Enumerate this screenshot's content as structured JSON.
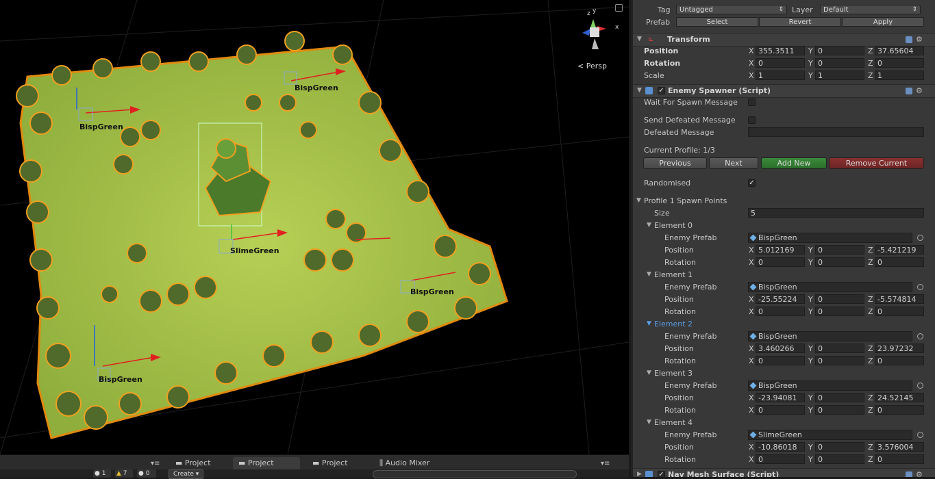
{
  "scene": {
    "persp_label": "Persp",
    "gizmo_axes": {
      "y": "y",
      "z": "z",
      "x": "x"
    },
    "object_labels": [
      "BispGreen",
      "BispGreen",
      "SlimeGreen",
      "BispGreen",
      "BispGreen"
    ]
  },
  "bottom": {
    "tabs": [
      "Project",
      "Project",
      "Project",
      "Audio Mixer"
    ],
    "create_label": "Create",
    "console_counts": [
      "1",
      "7",
      "0"
    ]
  },
  "inspector": {
    "tag_label": "Tag",
    "tag_value": "Untagged",
    "layer_label": "Layer",
    "layer_value": "Default",
    "prefab_label": "Prefab",
    "prefab_buttons": [
      "Select",
      "Revert",
      "Apply"
    ],
    "transform": {
      "title": "Transform",
      "position": {
        "label": "Position",
        "x": "355.3511",
        "y": "0",
        "z": "37.65604"
      },
      "rotation": {
        "label": "Rotation",
        "x": "0",
        "y": "0",
        "z": "0"
      },
      "scale": {
        "label": "Scale",
        "x": "1",
        "y": "1",
        "z": "1"
      }
    },
    "spawner": {
      "title": "Enemy Spawner (Script)",
      "wait_label": "Wait For Spawn Message",
      "send_label": "Send Defeated Message",
      "defeated_label": "Defeated Message",
      "current_profile": "Current Profile: 1/3",
      "buttons": {
        "previous": "Previous",
        "next": "Next",
        "add": "Add New",
        "remove": "Remove Current"
      },
      "randomised_label": "Randomised",
      "points_label": "Profile 1 Spawn Points",
      "size_label": "Size",
      "size_value": "5",
      "field_labels": {
        "prefab": "Enemy Prefab",
        "position": "Position",
        "rotation": "Rotation"
      },
      "elements": [
        {
          "name": "Element 0",
          "prefab": "BispGreen",
          "px": "5.012169",
          "py": "0",
          "pz": "-5.421219",
          "rx": "0",
          "ry": "0",
          "rz": "0"
        },
        {
          "name": "Element 1",
          "prefab": "BispGreen",
          "px": "-25.55224",
          "py": "0",
          "pz": "-5.574814",
          "rx": "0",
          "ry": "0",
          "rz": "0"
        },
        {
          "name": "Element 2",
          "prefab": "BispGreen",
          "px": "3.460266",
          "py": "0",
          "pz": "23.97232",
          "rx": "0",
          "ry": "0",
          "rz": "0"
        },
        {
          "name": "Element 3",
          "prefab": "BispGreen",
          "px": "-23.94081",
          "py": "0",
          "pz": "24.52145",
          "rx": "0",
          "ry": "0",
          "rz": "0"
        },
        {
          "name": "Element 4",
          "prefab": "SlimeGreen",
          "px": "-10.86018",
          "py": "0",
          "pz": "3.576004",
          "rx": "0",
          "ry": "0",
          "rz": "0"
        }
      ]
    },
    "navmesh_title": "Nav Mesh Surface (Script)"
  }
}
